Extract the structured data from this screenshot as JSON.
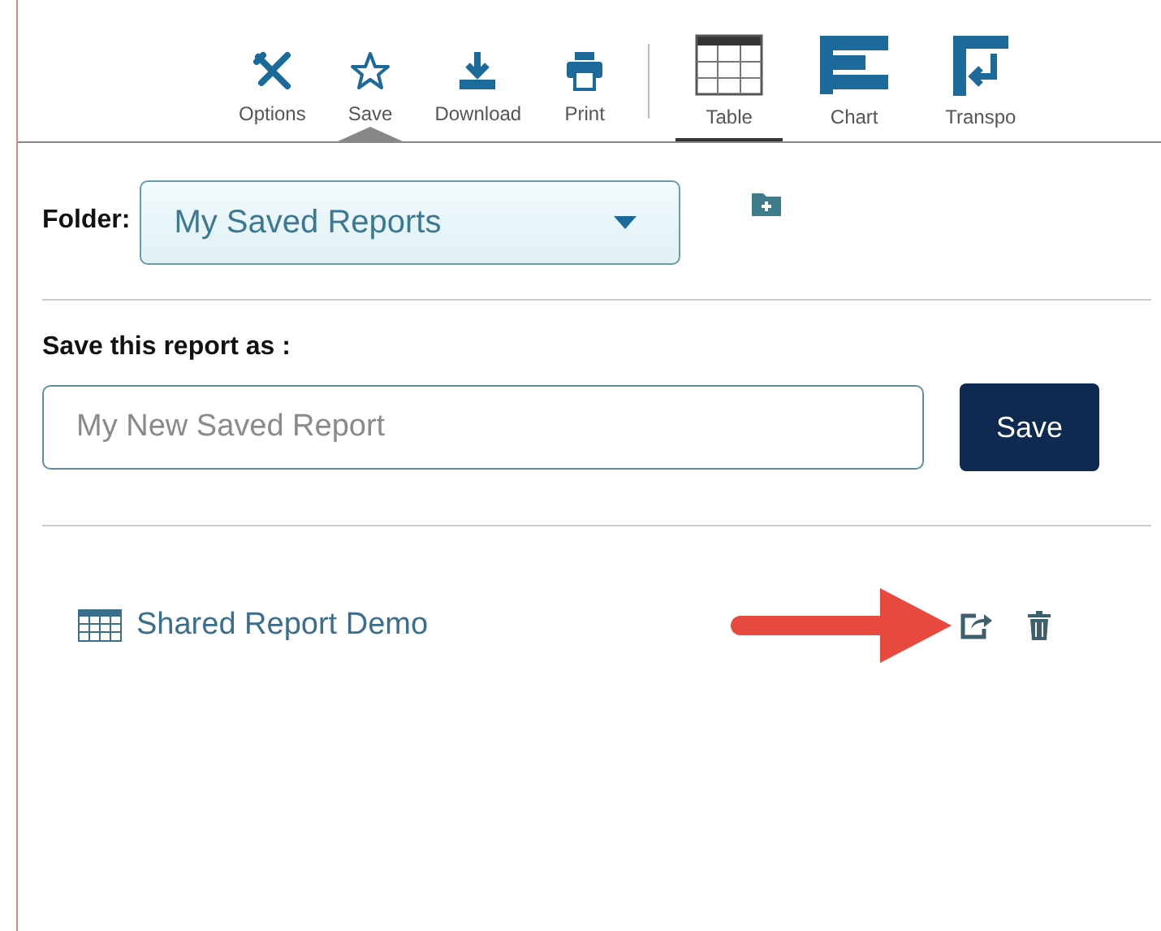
{
  "toolbar": [
    {
      "kind": "action",
      "label": "Options",
      "open": false
    },
    {
      "kind": "action",
      "label": "Save",
      "open": true
    },
    {
      "kind": "action",
      "label": "Download",
      "open": false
    },
    {
      "kind": "action",
      "label": "Print",
      "open": false
    },
    {
      "kind": "view",
      "label": "Table",
      "selected": true
    },
    {
      "kind": "view",
      "label": "Chart",
      "selected": false
    },
    {
      "kind": "view",
      "label": "Transpo",
      "selected": false
    }
  ],
  "folder": {
    "label": "Folder:",
    "value": "My Saved Reports"
  },
  "save_as": {
    "label": "Save this report as :",
    "placeholder": "My New Saved Report",
    "button": "Save"
  },
  "reports": [
    {
      "name": "Shared Report Demo"
    }
  ]
}
